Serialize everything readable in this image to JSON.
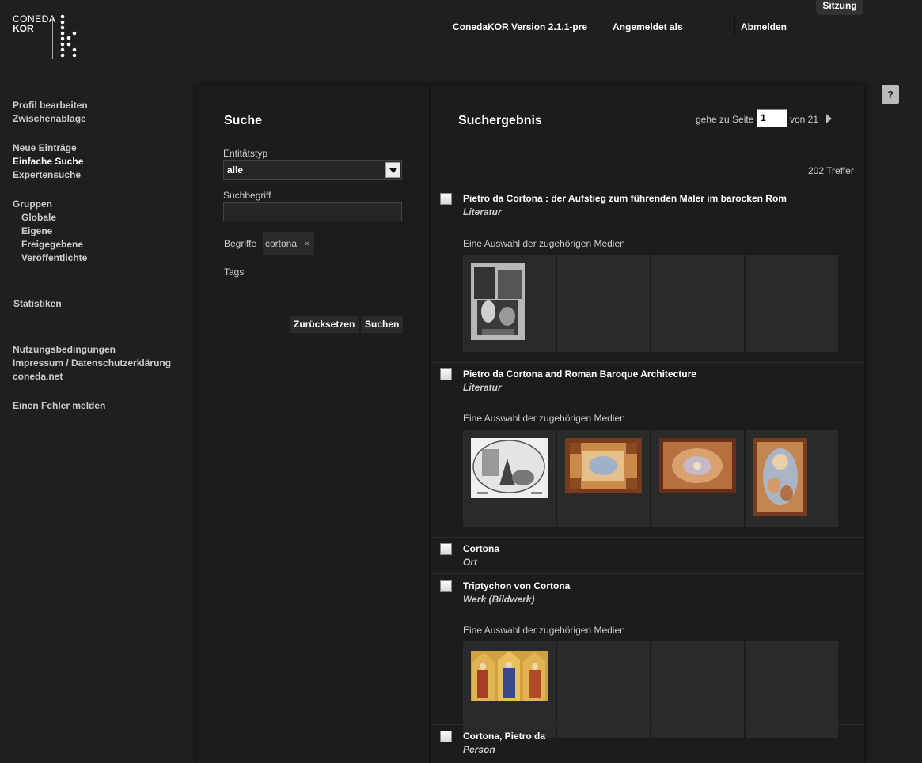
{
  "logo": {
    "line1": "CONEDA",
    "line2": "KOR"
  },
  "header": {
    "version": "ConedaKOR Version 2.1.1-pre",
    "logged_in": "Angemeldet als",
    "logout": "Abmelden",
    "session": "Sitzung"
  },
  "sidebar": {
    "profile": "Profil bearbeiten",
    "clipboard": "Zwischenablage",
    "new_entries": "Neue Einträge",
    "simple_search": "Einfache Suche",
    "expert_search": "Expertensuche",
    "groups": "Gruppen",
    "global": "Globale",
    "own": "Eigene",
    "shared": "Freigegebene",
    "published": "Veröffentlichte",
    "statistics": "Statistiken",
    "terms": "Nutzungsbedingungen",
    "imprint": "Impressum / Datenschutzerklärung",
    "coneda": "coneda.net",
    "report_bug": "Einen Fehler melden"
  },
  "search": {
    "title": "Suche",
    "entity_type_label": "Entitätstyp",
    "entity_type_value": "alle",
    "term_label": "Suchbegriff",
    "term_value": "",
    "concepts_label": "Begriffe",
    "concept_tag": "cortona",
    "tag_remove": "×",
    "tags_label": "Tags",
    "reset": "Zurücksetzen",
    "submit": "Suchen"
  },
  "results": {
    "title": "Suchergebnis",
    "goto_page": "gehe zu Seite",
    "page": "1",
    "of_pages": "von 21",
    "hits": "202 Treffer",
    "media_label": "Eine Auswahl der zugehörigen Medien",
    "items": [
      {
        "title": "Pietro da Cortona : der Aufstieg zum führenden Maler im barocken Rom",
        "type": "Literatur"
      },
      {
        "title": "Pietro da Cortona and Roman Baroque Architecture",
        "type": "Literatur"
      },
      {
        "title": "Cortona",
        "type": "Ort"
      },
      {
        "title": "Triptychon von Cortona",
        "type": "Werk (Bildwerk)"
      },
      {
        "title": "Cortona, Pietro da",
        "type": "Person"
      }
    ]
  },
  "help": "?"
}
